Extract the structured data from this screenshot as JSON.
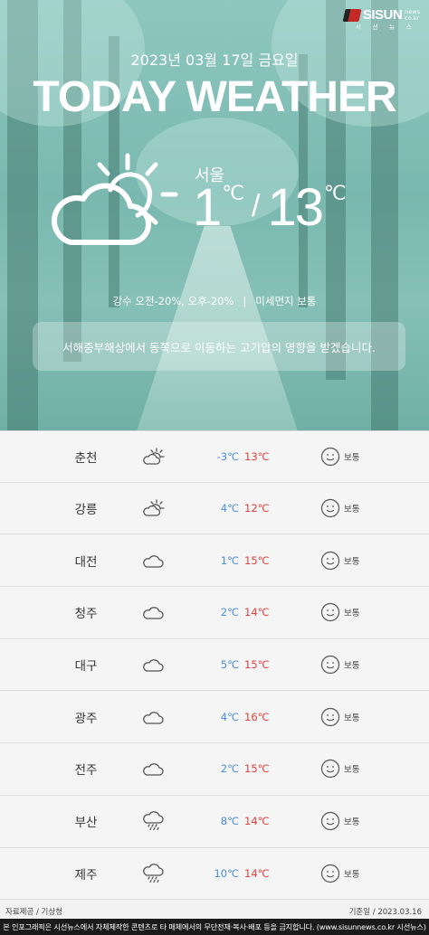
{
  "brand": {
    "name": "SISUN",
    "side_top": "news",
    "side_bottom": "co.kr",
    "sub": "시 선 뉴 스"
  },
  "header": {
    "date": "2023년 03월 17일 금요일",
    "title": "TODAY WEATHER"
  },
  "main": {
    "city": "서울",
    "low": "1",
    "high": "13",
    "unit": "℃",
    "slash": "/",
    "icon": "partly-cloudy-icon",
    "precip": "강수 오전-20%, 오후-20%",
    "separator": "|",
    "dust": "미세먼지 보통",
    "summary": "서해중부해상에서 동쪽으로 이동하는 고기압의 영향을 받겠습니다."
  },
  "colors": {
    "low_temp": "#4a8fe0",
    "high_temp": "#e0403c",
    "footer_bg": "#1a1a1a",
    "brand_red": "#c62828"
  },
  "rows": [
    {
      "city": "춘천",
      "icon": "partly-cloudy-icon",
      "low": "-3℃",
      "high": "13℃",
      "dust": "보통"
    },
    {
      "city": "강릉",
      "icon": "partly-cloudy-icon",
      "low": "4℃",
      "high": "12℃",
      "dust": "보통"
    },
    {
      "city": "대전",
      "icon": "cloud-icon",
      "low": "1℃",
      "high": "15℃",
      "dust": "보통"
    },
    {
      "city": "청주",
      "icon": "cloud-icon",
      "low": "2℃",
      "high": "14℃",
      "dust": "보통"
    },
    {
      "city": "대구",
      "icon": "cloud-icon",
      "low": "5℃",
      "high": "15℃",
      "dust": "보통"
    },
    {
      "city": "광주",
      "icon": "cloud-icon",
      "low": "4℃",
      "high": "16℃",
      "dust": "보통"
    },
    {
      "city": "전주",
      "icon": "cloud-icon",
      "low": "2℃",
      "high": "15℃",
      "dust": "보통"
    },
    {
      "city": "부산",
      "icon": "rain-icon",
      "low": "8℃",
      "high": "14℃",
      "dust": "보통"
    },
    {
      "city": "제주",
      "icon": "rain-icon",
      "low": "10℃",
      "high": "14℃",
      "dust": "보통"
    }
  ],
  "source": {
    "left": "자료제공 / 기상청",
    "right": "기준일 / 2023.03.16"
  },
  "footer": "본 인포그래픽은 시선뉴스에서 자체제작한 콘텐츠로 타 매체에서의 무단전재·복사·배포 등을 금지합니다. (www.sisunnews.co.kr 시선뉴스)"
}
